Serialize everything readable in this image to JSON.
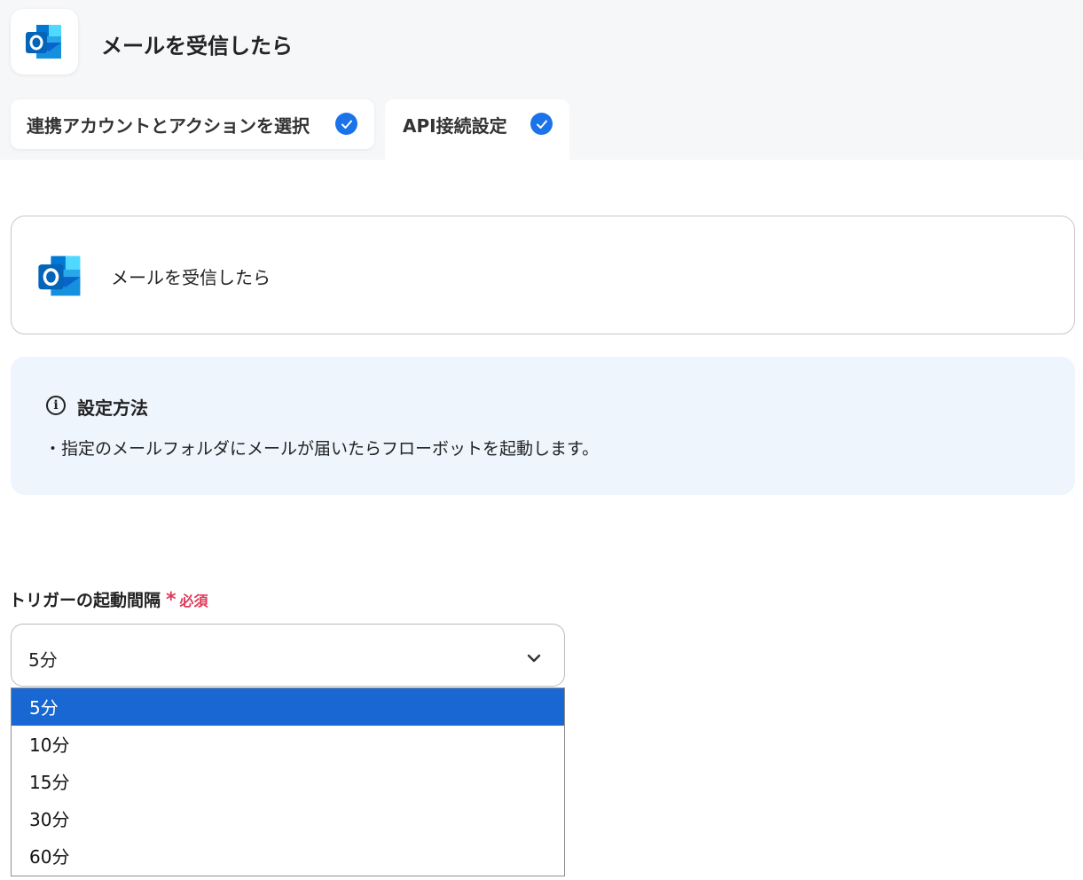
{
  "header": {
    "title": "メールを受信したら",
    "app_icon": "outlook-icon"
  },
  "tabs": [
    {
      "label": "連携アカウントとアクションを選択",
      "completed": true
    },
    {
      "label": "API接続設定",
      "completed": true
    }
  ],
  "action": {
    "label": "メールを受信したら",
    "icon": "outlook-icon"
  },
  "info": {
    "title": "設定方法",
    "text": "・指定のメールフォルダにメールが届いたらフローボットを起動します。"
  },
  "field": {
    "label": "トリガーの起動間隔",
    "required_mark": "*",
    "required_text": "必須",
    "selected_value": "5分",
    "options": [
      "5分",
      "10分",
      "15分",
      "30分",
      "60分"
    ],
    "highlighted_index": 0
  },
  "colors": {
    "accent": "#1a73e8",
    "required": "#e03a5a",
    "selected_option": "#1967d2",
    "info_bg": "#eef5fd"
  }
}
